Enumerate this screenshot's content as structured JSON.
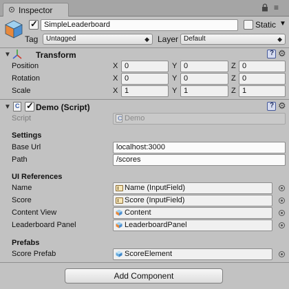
{
  "window": {
    "tab_title": "Inspector",
    "menu_glyph": "≡"
  },
  "gameobject": {
    "name": "SimpleLeaderboard",
    "active": true,
    "static_label": "Static",
    "static_checked": false,
    "tag_label": "Tag",
    "tag_value": "Untagged",
    "layer_label": "Layer",
    "layer_value": "Default"
  },
  "transform": {
    "title": "Transform",
    "rows": [
      {
        "label": "Position",
        "x": "0",
        "y": "0",
        "z": "0"
      },
      {
        "label": "Rotation",
        "x": "0",
        "y": "0",
        "z": "0"
      },
      {
        "label": "Scale",
        "x": "1",
        "y": "1",
        "z": "1"
      }
    ],
    "axis": {
      "x": "X",
      "y": "Y",
      "z": "Z"
    }
  },
  "demo": {
    "title": "Demo (Script)",
    "enabled": true,
    "script_label": "Script",
    "script_value": "Demo",
    "settings_header": "Settings",
    "base_url_label": "Base Url",
    "base_url_value": "localhost:3000",
    "path_label": "Path",
    "path_value": "/scores",
    "ui_header": "UI References",
    "name_label": "Name",
    "name_value": "Name (InputField)",
    "score_label": "Score",
    "score_value": "Score (InputField)",
    "content_label": "Content View",
    "content_value": "Content",
    "panel_label": "Leaderboard Panel",
    "panel_value": "LeaderboardPanel",
    "prefabs_header": "Prefabs",
    "score_prefab_label": "Score Prefab",
    "score_prefab_value": "ScoreElement"
  },
  "add_component_label": "Add Component",
  "colors": {
    "panel_bg": "#c2c2c2",
    "titlebar_bg": "#a5a5a5",
    "field_bg": "#f0f0f0",
    "help_blue": "#45589a"
  }
}
